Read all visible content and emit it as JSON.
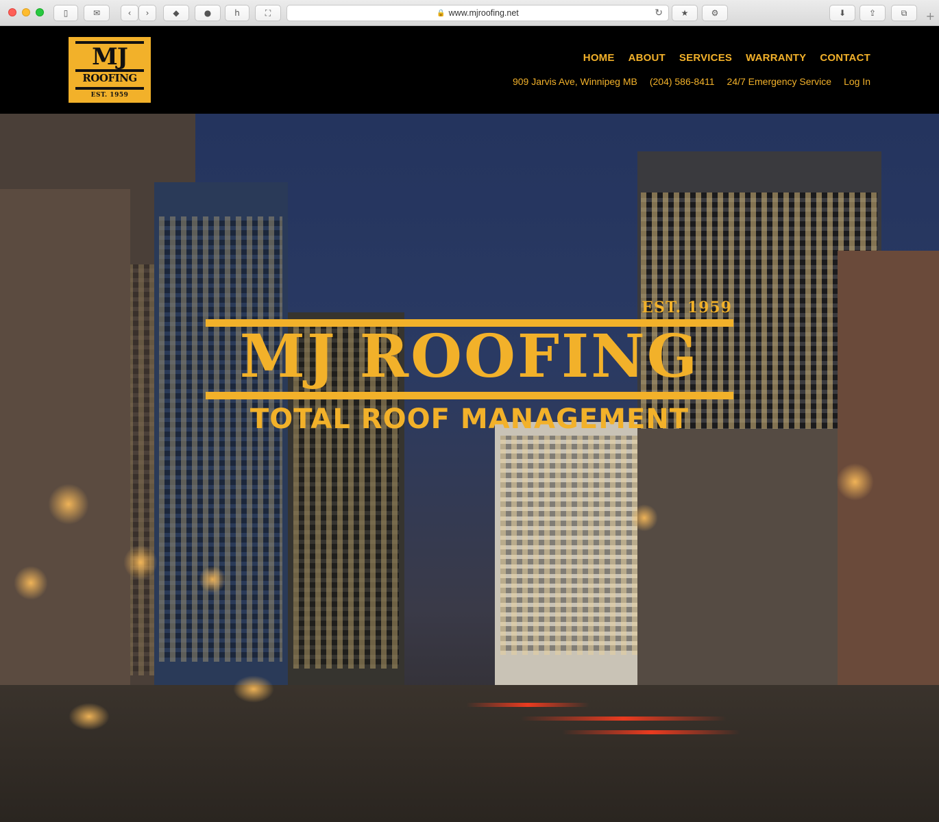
{
  "browser": {
    "url": "www.mjroofing.net",
    "lock_icon": "lock-icon",
    "reload_icon": "reload-icon"
  },
  "site": {
    "logo": {
      "name_top": "MJ",
      "name_bottom": "ROOFING",
      "established": "EST. 1959"
    },
    "nav": [
      {
        "label": "HOME"
      },
      {
        "label": "ABOUT"
      },
      {
        "label": "SERVICES"
      },
      {
        "label": "WARRANTY"
      },
      {
        "label": "CONTACT"
      }
    ],
    "info": {
      "address": "909 Jarvis Ave, Winnipeg MB",
      "phone": "(204) 586-8411",
      "emergency": "24/7 Emergency Service",
      "login": "Log In"
    },
    "hero": {
      "established": "EST. 1959",
      "title": "MJ ROOFING",
      "tagline": "TOTAL ROOF MANAGEMENT"
    }
  },
  "colors": {
    "brand_yellow": "#f2b12a",
    "header_bg": "#000000"
  }
}
